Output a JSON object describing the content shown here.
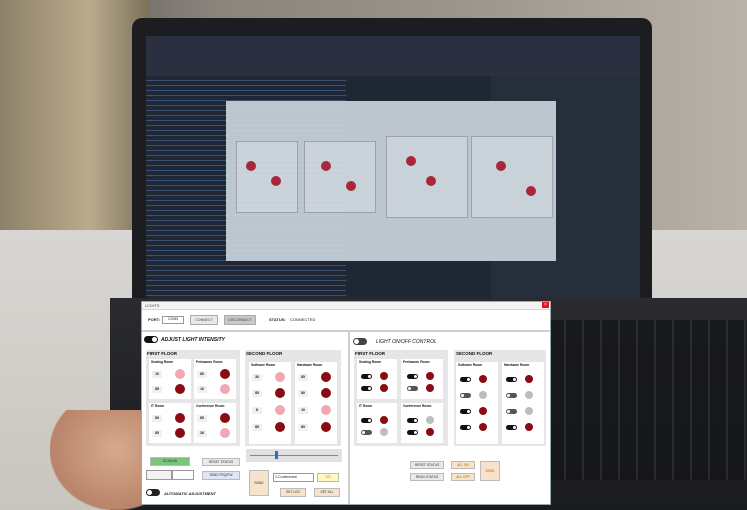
{
  "window": {
    "title": "LIGHTS"
  },
  "connection": {
    "port_label": "PORT:",
    "port_value": "COM3",
    "connect_label": "CONNECT",
    "disconnect_label": "DISCONNECT",
    "status_label": "STATUS:",
    "status_value": "CONNECTED"
  },
  "intensity": {
    "header": "ADJUST LIGHT INTENSITY",
    "first_floor": {
      "title": "FIRST FLOOR",
      "rooms": [
        {
          "name": "Seating Room",
          "values": [
            "10",
            "85"
          ]
        },
        {
          "name": "Perhaaron Room",
          "values": [
            "85",
            "10"
          ]
        },
        {
          "name": "IT Room",
          "values": [
            "89",
            "85"
          ]
        },
        {
          "name": "Conference Room",
          "values": [
            "85",
            "26"
          ]
        }
      ]
    },
    "second_floor": {
      "title": "SECOND FLOOR",
      "rooms": [
        {
          "name": "Software Room",
          "values": [
            "30",
            "85",
            "8",
            "85"
          ]
        },
        {
          "name": "Hardware Room",
          "values": [
            "85",
            "80",
            "10",
            "89"
          ]
        }
      ]
    },
    "controls": {
      "scan_label": "SCAN/4N",
      "reset_label": "RESET STATUS",
      "send_freq_label": "SEND FRQ/FW",
      "conference_select": "2-Conferencei",
      "send_label": "SEND",
      "set_led_label": "SET LED",
      "set_all_label": "SET ALL",
      "small_value": "100",
      "auto_label": "AUTOMATIC ADJUSTMENT"
    }
  },
  "onoff": {
    "header": "LIGHT ON/OFF CONTROL",
    "first_floor": {
      "title": "FIRST FLOOR",
      "rooms": [
        {
          "name": "Seating Room"
        },
        {
          "name": "Perhaaron Room"
        },
        {
          "name": "IT Room"
        },
        {
          "name": "Conference Room"
        }
      ]
    },
    "second_floor": {
      "title": "SECOND FLOOR",
      "rooms": [
        {
          "name": "Software Room"
        },
        {
          "name": "Hardware Room"
        }
      ]
    },
    "controls": {
      "reset_label": "RESET STATUS",
      "read_label": "READ STATUS",
      "all_on_label": "ALL ON",
      "all_off_label": "ALL OFF",
      "send_label": "SEND"
    }
  },
  "colors": {
    "bulb_dark": "#8b0b14",
    "bulb_light": "#f0a9b2",
    "lamp_off": "#bdbdbd",
    "green_btn": "#7bc47f",
    "peach_btn": "#f7e3cc"
  }
}
